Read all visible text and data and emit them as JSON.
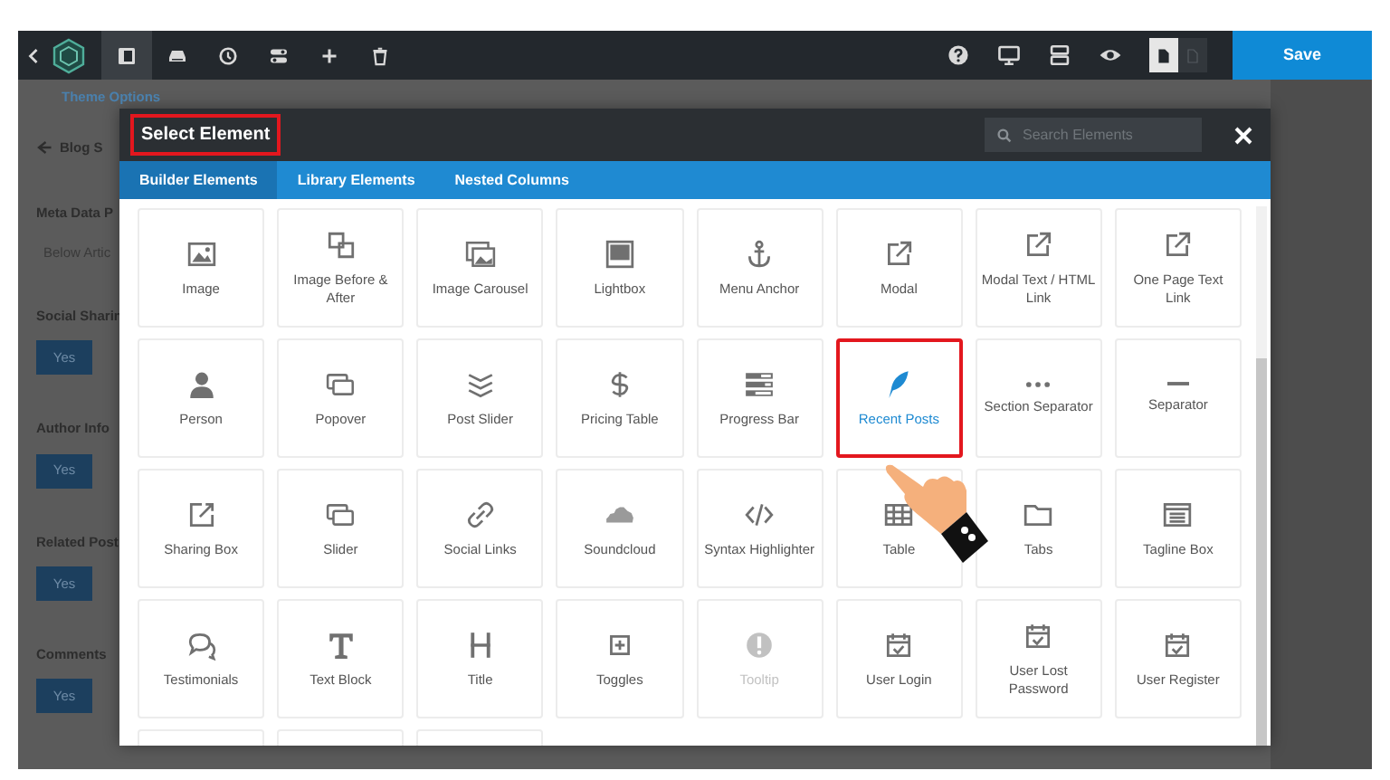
{
  "toolbar": {
    "left_tools": [
      {
        "selected": true
      },
      {
        "selected": false
      },
      {
        "selected": false
      },
      {
        "selected": false
      },
      {
        "selected": false
      },
      {
        "selected": false
      }
    ],
    "view_toggle": [
      {
        "selected": true
      },
      {
        "selected": false
      }
    ],
    "save_label": "Save"
  },
  "background_panel": {
    "items": [
      {
        "kind": "link",
        "text": "Theme Options"
      },
      {
        "kind": "heading",
        "text": "Blog S"
      },
      {
        "kind": "label",
        "text": "Meta Data P"
      },
      {
        "kind": "select",
        "text": "Below Artic"
      },
      {
        "kind": "label",
        "text": "Social Sharin"
      },
      {
        "kind": "button",
        "text": "Yes"
      },
      {
        "kind": "label",
        "text": "Author Info"
      },
      {
        "kind": "button",
        "text": "Yes"
      },
      {
        "kind": "label",
        "text": "Related Post"
      },
      {
        "kind": "button",
        "text": "Yes"
      },
      {
        "kind": "label",
        "text": "Comments"
      },
      {
        "kind": "button",
        "text": "Yes"
      }
    ]
  },
  "modal": {
    "title": "Select Element",
    "title_highlighted": true,
    "search": {
      "placeholder": "Search Elements"
    },
    "tabs": [
      {
        "label": "Builder Elements",
        "selected": true
      },
      {
        "label": "Library Elements",
        "selected": false
      },
      {
        "label": "Nested Columns",
        "selected": false
      }
    ],
    "elements": [
      {
        "label": "Image",
        "selected": false,
        "disabled": false,
        "highlighted": false
      },
      {
        "label": "Image Before & After",
        "selected": false,
        "disabled": false,
        "highlighted": false
      },
      {
        "label": "Image Carousel",
        "selected": false,
        "disabled": false,
        "highlighted": false
      },
      {
        "label": "Lightbox",
        "selected": false,
        "disabled": false,
        "highlighted": false
      },
      {
        "label": "Menu Anchor",
        "selected": false,
        "disabled": false,
        "highlighted": false
      },
      {
        "label": "Modal",
        "selected": false,
        "disabled": false,
        "highlighted": false
      },
      {
        "label": "Modal Text / HTML Link",
        "selected": false,
        "disabled": false,
        "highlighted": false
      },
      {
        "label": "One Page Text Link",
        "selected": false,
        "disabled": false,
        "highlighted": false
      },
      {
        "label": "Person",
        "selected": false,
        "disabled": false,
        "highlighted": false
      },
      {
        "label": "Popover",
        "selected": false,
        "disabled": false,
        "highlighted": false
      },
      {
        "label": "Post Slider",
        "selected": false,
        "disabled": false,
        "highlighted": false
      },
      {
        "label": "Pricing Table",
        "selected": false,
        "disabled": false,
        "highlighted": false
      },
      {
        "label": "Progress Bar",
        "selected": false,
        "disabled": false,
        "highlighted": false
      },
      {
        "label": "Recent Posts",
        "selected": true,
        "disabled": false,
        "highlighted": true
      },
      {
        "label": "Section Separator",
        "selected": false,
        "disabled": false,
        "highlighted": false
      },
      {
        "label": "Separator",
        "selected": false,
        "disabled": false,
        "highlighted": false
      },
      {
        "label": "Sharing Box",
        "selected": false,
        "disabled": false,
        "highlighted": false
      },
      {
        "label": "Slider",
        "selected": false,
        "disabled": false,
        "highlighted": false
      },
      {
        "label": "Social Links",
        "selected": false,
        "disabled": false,
        "highlighted": false
      },
      {
        "label": "Soundcloud",
        "selected": false,
        "disabled": false,
        "highlighted": false
      },
      {
        "label": "Syntax Highlighter",
        "selected": false,
        "disabled": false,
        "highlighted": false
      },
      {
        "label": "Table",
        "selected": false,
        "disabled": false,
        "highlighted": false
      },
      {
        "label": "Tabs",
        "selected": false,
        "disabled": false,
        "highlighted": false
      },
      {
        "label": "Tagline Box",
        "selected": false,
        "disabled": false,
        "highlighted": false
      },
      {
        "label": "Testimonials",
        "selected": false,
        "disabled": false,
        "highlighted": false
      },
      {
        "label": "Text Block",
        "selected": false,
        "disabled": false,
        "highlighted": false
      },
      {
        "label": "Title",
        "selected": false,
        "disabled": false,
        "highlighted": false
      },
      {
        "label": "Toggles",
        "selected": false,
        "disabled": false,
        "highlighted": false
      },
      {
        "label": "Tooltip",
        "selected": false,
        "disabled": true,
        "highlighted": false
      },
      {
        "label": "User Login",
        "selected": false,
        "disabled": false,
        "highlighted": false
      },
      {
        "label": "User Lost Password",
        "selected": false,
        "disabled": false,
        "highlighted": false
      },
      {
        "label": "User Register",
        "selected": false,
        "disabled": false,
        "highlighted": false
      }
    ]
  }
}
